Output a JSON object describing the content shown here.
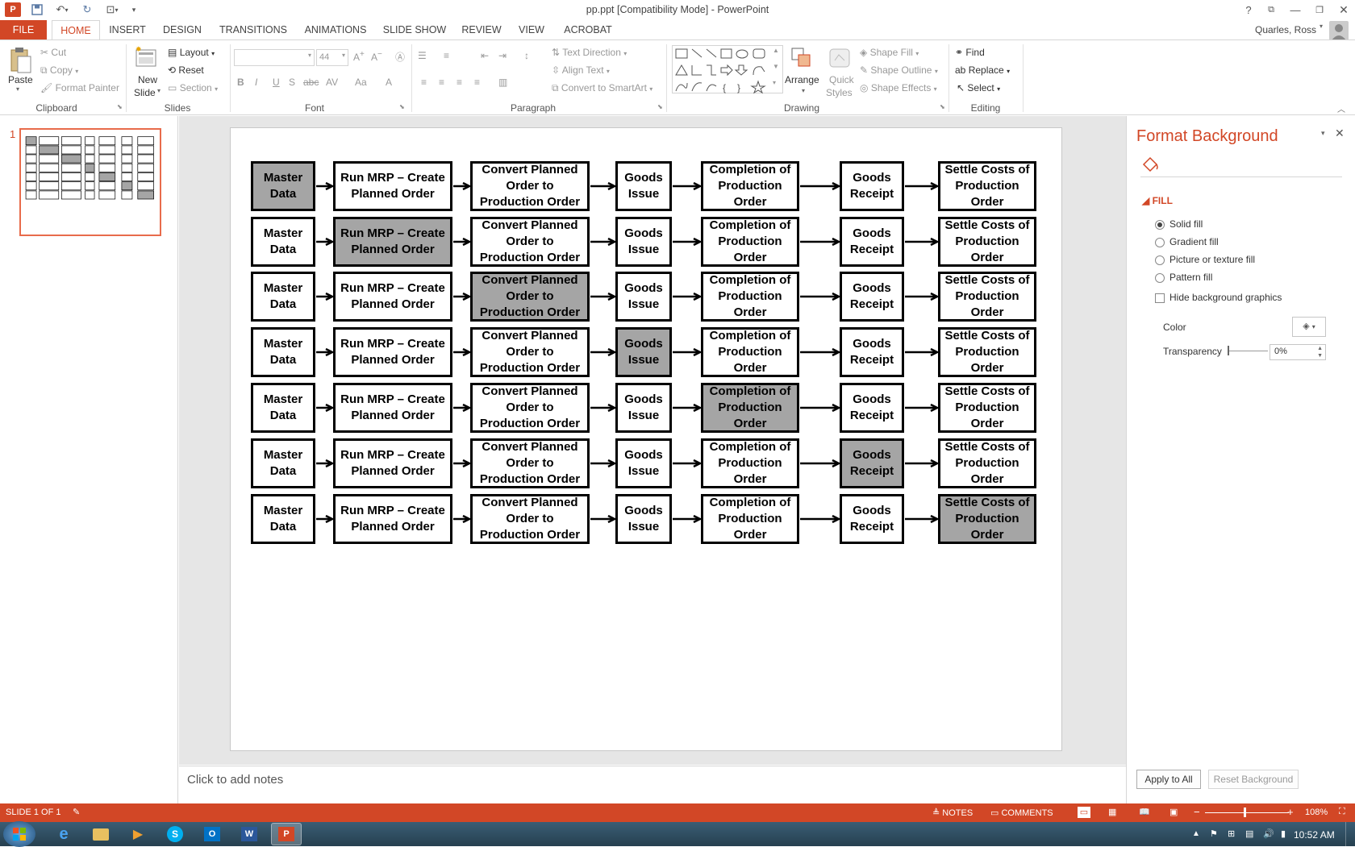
{
  "window": {
    "title": "pp.ppt [Compatibility Mode] - PowerPoint",
    "user": "Quarles, Ross",
    "help": "?"
  },
  "tabs": [
    "FILE",
    "HOME",
    "INSERT",
    "DESIGN",
    "TRANSITIONS",
    "ANIMATIONS",
    "SLIDE SHOW",
    "REVIEW",
    "VIEW",
    "ACROBAT"
  ],
  "active_tab": "HOME",
  "ribbon": {
    "clipboard": {
      "label": "Clipboard",
      "paste": "Paste",
      "cut": "Cut",
      "copy": "Copy",
      "format_painter": "Format Painter"
    },
    "slides": {
      "label": "Slides",
      "new_slide_1": "New",
      "new_slide_2": "Slide",
      "layout": "Layout",
      "reset": "Reset",
      "section": "Section"
    },
    "font": {
      "label": "Font",
      "size": "44"
    },
    "paragraph": {
      "label": "Paragraph",
      "text_direction": "Text Direction",
      "align_text": "Align Text",
      "convert_smartart": "Convert to SmartArt"
    },
    "drawing": {
      "label": "Drawing",
      "arrange": "Arrange",
      "quick_styles_1": "Quick",
      "quick_styles_2": "Styles",
      "shape_fill": "Shape Fill",
      "shape_outline": "Shape Outline",
      "shape_effects": "Shape Effects"
    },
    "editing": {
      "label": "Editing",
      "find": "Find",
      "replace": "Replace",
      "select": "Select"
    }
  },
  "slide_panel": {
    "number": "1"
  },
  "slide": {
    "rows": [
      [
        "Master Data",
        "Run MRP – Create Planned Order",
        "Convert Planned Order to Production Order",
        "Goods Issue",
        "Completion of Production Order",
        "Goods Receipt",
        "Settle Costs of Production Order"
      ]
    ],
    "highlight_index_per_row": [
      0,
      1,
      2,
      3,
      4,
      5,
      6
    ],
    "highlight_color": "#a5a5a5"
  },
  "notes_placeholder": "Click to add notes",
  "format_background": {
    "title": "Format Background",
    "section": "FILL",
    "options": [
      "Solid fill",
      "Gradient fill",
      "Picture or texture fill",
      "Pattern fill"
    ],
    "selected": "Solid fill",
    "hide_bg_graphics": "Hide background graphics",
    "color_label": "Color",
    "transparency_label": "Transparency",
    "transparency_value": "0%",
    "apply_all": "Apply to All",
    "reset_bg": "Reset Background"
  },
  "status": {
    "slide_info": "SLIDE 1 OF 1",
    "notes": "NOTES",
    "comments": "COMMENTS",
    "zoom": "108%"
  },
  "taskbar": {
    "time": "10:52 AM"
  },
  "colors": {
    "accent": "#d24726",
    "tab_active": "#d24726"
  }
}
